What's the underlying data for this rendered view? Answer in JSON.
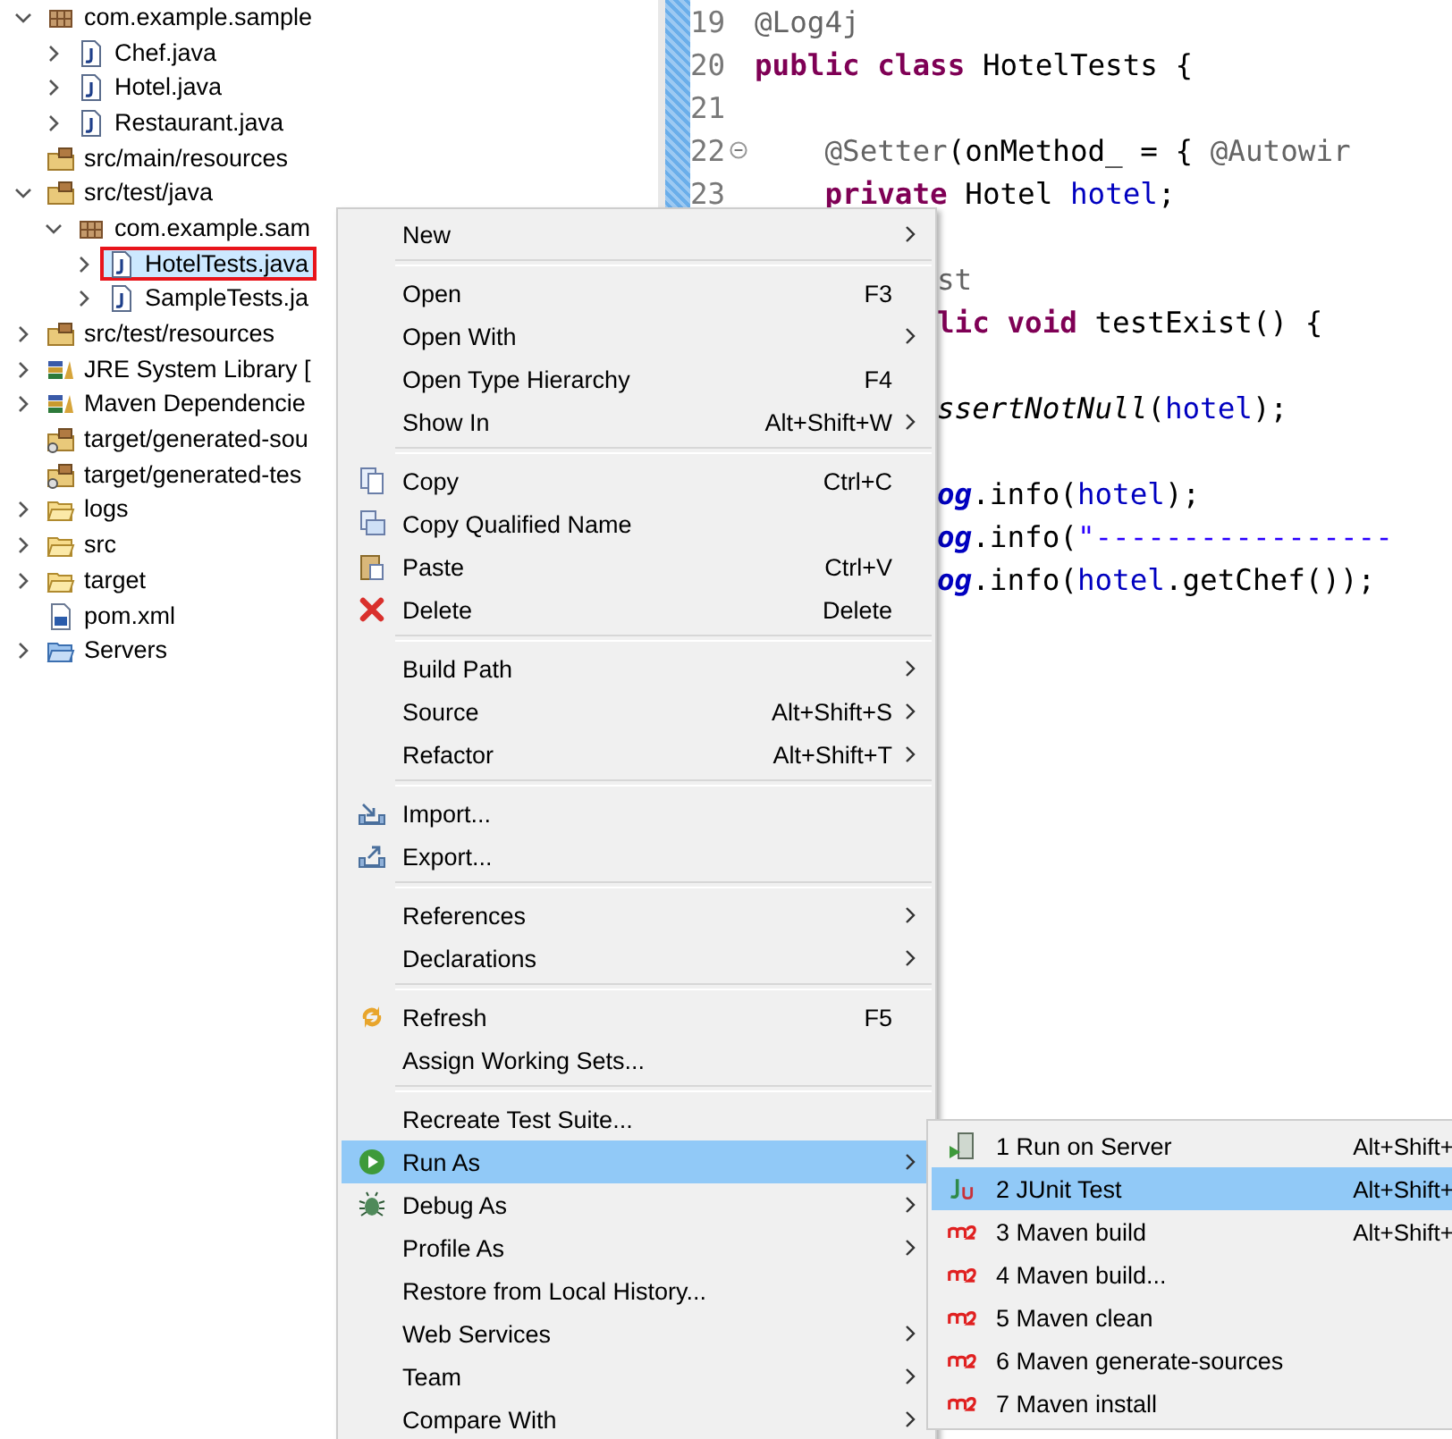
{
  "explorer": {
    "items": [
      {
        "children": [
          {
            "label": "com.example.sample",
            "kind": "package",
            "expanded": true,
            "children": [
              {
                "label": "Chef.java",
                "kind": "java",
                "expanded": false,
                "selected": false
              },
              {
                "label": "Hotel.java",
                "kind": "java",
                "expanded": false,
                "selected": false
              },
              {
                "label": "Restaurant.java",
                "kind": "java",
                "expanded": false,
                "selected": false
              }
            ]
          },
          {
            "label": "src/main/resources",
            "kind": "resource-folder"
          },
          {
            "label": "src/test/java",
            "kind": "source-folder",
            "expanded": true,
            "children": [
              {
                "label": "com.example.sam",
                "kind": "package",
                "expanded": true,
                "children": [
                  {
                    "label": "HotelTests.java",
                    "kind": "java",
                    "expanded": false,
                    "selected": true,
                    "marked": true
                  },
                  {
                    "label": "SampleTests.ja",
                    "kind": "java",
                    "expanded": false,
                    "selected": false
                  }
                ]
              }
            ]
          },
          {
            "label": "src/test/resources",
            "kind": "resource-folder",
            "expanded": false
          },
          {
            "label": "JRE System Library [",
            "kind": "library",
            "expanded": false
          },
          {
            "label": "Maven Dependencie",
            "kind": "library",
            "expanded": false
          },
          {
            "label": "target/generated-sou",
            "kind": "generated-folder"
          },
          {
            "label": "target/generated-tes",
            "kind": "generated-folder"
          },
          {
            "label": "logs",
            "kind": "folder",
            "expanded": false
          },
          {
            "label": "src",
            "kind": "folder",
            "expanded": false
          },
          {
            "label": "target",
            "kind": "folder",
            "expanded": false
          },
          {
            "label": "pom.xml",
            "kind": "pom"
          }
        ]
      },
      {
        "label": "Servers",
        "kind": "servers-folder",
        "expanded": false
      }
    ]
  },
  "editor": {
    "lines": [
      {
        "number": "19",
        "kind": "full",
        "segments": [
          {
            "text": "@Log4j",
            "kind": "annotation"
          }
        ]
      },
      {
        "number": "20",
        "kind": "full",
        "segments": [
          {
            "text": "public class ",
            "kind": "keyword"
          },
          {
            "text": "HotelTests {",
            "kind": "plain"
          }
        ]
      },
      {
        "number": "21",
        "kind": "full"
      },
      {
        "number": "22",
        "kind": "full",
        "fold": true,
        "segments": [
          {
            "text": "    @Setter",
            "kind": "annotation"
          },
          {
            "text": "(onMethod_ = { ",
            "kind": "plain"
          },
          {
            "text": "@Autowir",
            "kind": "annotation"
          }
        ]
      },
      {
        "number": "23",
        "kind": "full",
        "segments": [
          {
            "text": "    private ",
            "kind": "keyword"
          },
          {
            "text": "Hotel ",
            "kind": "plain"
          },
          {
            "text": "hotel",
            "kind": "field"
          },
          {
            "text": ";",
            "kind": "plain"
          }
        ]
      },
      {
        "kind": "covered"
      },
      {
        "kind": "covered",
        "segments": [
          {
            "text": "st",
            "kind": "annotation"
          }
        ]
      },
      {
        "kind": "covered",
        "segments": [
          {
            "text": "lic void ",
            "kind": "keyword"
          },
          {
            "text": "testExist() {",
            "kind": "plain"
          }
        ]
      },
      {
        "kind": "covered"
      },
      {
        "kind": "covered",
        "segments": [
          {
            "text": "ssertNotNull",
            "kind": "static"
          },
          {
            "text": "(",
            "kind": "plain"
          },
          {
            "text": "hotel",
            "kind": "field"
          },
          {
            "text": ");",
            "kind": "plain"
          }
        ]
      },
      {
        "kind": "covered"
      },
      {
        "kind": "covered",
        "segments": [
          {
            "text": "og",
            "kind": "log"
          },
          {
            "text": ".info(",
            "kind": "plain"
          },
          {
            "text": "hotel",
            "kind": "field"
          },
          {
            "text": ");",
            "kind": "plain"
          }
        ]
      },
      {
        "kind": "covered",
        "segments": [
          {
            "text": "og",
            "kind": "log"
          },
          {
            "text": ".info(",
            "kind": "plain"
          },
          {
            "text": "\"-----------------",
            "kind": "string"
          }
        ]
      },
      {
        "kind": "covered",
        "segments": [
          {
            "text": "og",
            "kind": "log"
          },
          {
            "text": ".info(",
            "kind": "plain"
          },
          {
            "text": "hotel",
            "kind": "field"
          },
          {
            "text": ".getChef());",
            "kind": "plain"
          }
        ]
      }
    ]
  },
  "context_menu": {
    "items": [
      {
        "kind": "item",
        "label": "New",
        "submenu": true,
        "selected": false
      },
      {
        "kind": "separator"
      },
      {
        "kind": "item",
        "label": "Open",
        "shortcut": "F3",
        "selected": false
      },
      {
        "kind": "item",
        "label": "Open With",
        "submenu": true,
        "selected": false
      },
      {
        "kind": "item",
        "label": "Open Type Hierarchy",
        "shortcut": "F4",
        "selected": false
      },
      {
        "kind": "item",
        "label": "Show In",
        "shortcut": "Alt+Shift+W",
        "submenu": true,
        "selected": false
      },
      {
        "kind": "separator"
      },
      {
        "kind": "item",
        "label": "Copy",
        "shortcut": "Ctrl+C",
        "selected": false
      },
      {
        "kind": "item",
        "label": "Copy Qualified Name",
        "selected": false
      },
      {
        "kind": "item",
        "label": "Paste",
        "shortcut": "Ctrl+V",
        "selected": false
      },
      {
        "kind": "item",
        "label": "Delete",
        "shortcut": "Delete",
        "selected": false
      },
      {
        "kind": "separator"
      },
      {
        "kind": "item",
        "label": "Build Path",
        "submenu": true,
        "selected": false
      },
      {
        "kind": "item",
        "label": "Source",
        "shortcut": "Alt+Shift+S",
        "submenu": true,
        "selected": false
      },
      {
        "kind": "item",
        "label": "Refactor",
        "shortcut": "Alt+Shift+T",
        "submenu": true,
        "selected": false
      },
      {
        "kind": "separator"
      },
      {
        "kind": "item",
        "label": "Import...",
        "selected": false
      },
      {
        "kind": "item",
        "label": "Export...",
        "selected": false
      },
      {
        "kind": "separator"
      },
      {
        "kind": "item",
        "label": "References",
        "submenu": true,
        "selected": false
      },
      {
        "kind": "item",
        "label": "Declarations",
        "submenu": true,
        "selected": false
      },
      {
        "kind": "separator"
      },
      {
        "kind": "item",
        "label": "Refresh",
        "shortcut": "F5",
        "selected": false
      },
      {
        "kind": "item",
        "label": "Assign Working Sets...",
        "selected": false
      },
      {
        "kind": "separator"
      },
      {
        "kind": "item",
        "label": "Recreate Test Suite...",
        "selected": false
      },
      {
        "kind": "item",
        "label": "Run As",
        "submenu": true,
        "selected": true
      },
      {
        "kind": "item",
        "label": "Debug As",
        "submenu": true,
        "selected": false
      },
      {
        "kind": "item",
        "label": "Profile As",
        "submenu": true,
        "selected": false
      },
      {
        "kind": "item",
        "label": "Restore from Local History...",
        "selected": false
      },
      {
        "kind": "item",
        "label": "Web Services",
        "submenu": true,
        "selected": false
      },
      {
        "kind": "item",
        "label": "Team",
        "submenu": true,
        "selected": false
      },
      {
        "kind": "item",
        "label": "Compare With",
        "submenu": true,
        "selected": false
      }
    ]
  },
  "run_as_menu": {
    "items": [
      {
        "label": "1 Run on Server",
        "shortcut": "Alt+Shift+",
        "selected": false
      },
      {
        "label": "2 JUnit Test",
        "shortcut": "Alt+Shift+",
        "selected": true
      },
      {
        "label": "3 Maven build",
        "shortcut": "Alt+Shift+",
        "selected": false
      },
      {
        "label": "4 Maven build...",
        "selected": false
      },
      {
        "label": "5 Maven clean",
        "selected": false
      },
      {
        "label": "6 Maven generate-sources",
        "selected": false
      },
      {
        "label": "7 Maven install",
        "selected": false
      }
    ]
  }
}
